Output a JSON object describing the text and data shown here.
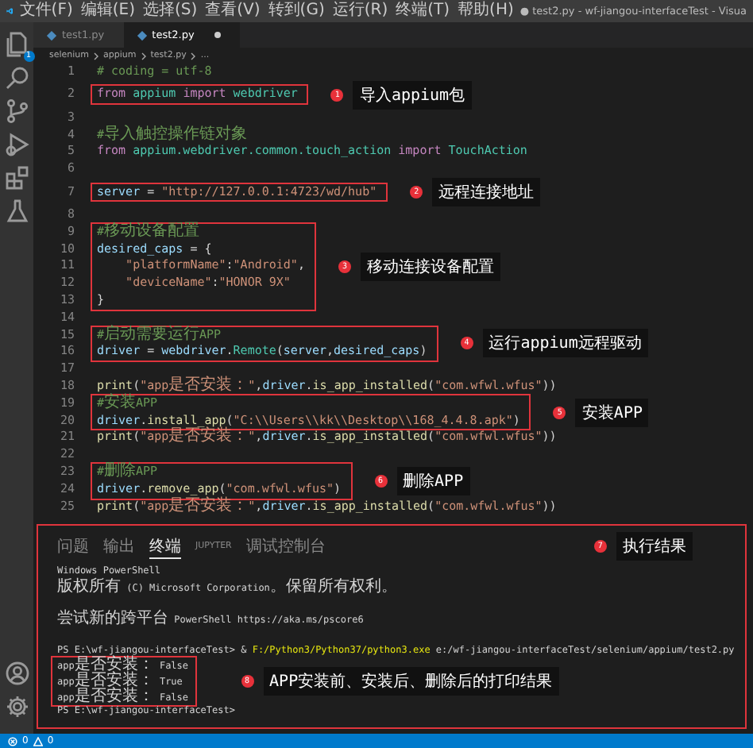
{
  "menu": [
    "文件(F)",
    "编辑(E)",
    "选择(S)",
    "查看(V)",
    "转到(G)",
    "运行(R)",
    "终端(T)",
    "帮助(H)"
  ],
  "window": {
    "title": "● test2.py - wf-jiangou-interfaceTest - Visua"
  },
  "activity_bar": {
    "top": [
      {
        "kind": "files",
        "badge": "1"
      },
      {
        "kind": "search"
      },
      {
        "kind": "source-control"
      },
      {
        "kind": "run"
      },
      {
        "kind": "extensions"
      },
      {
        "kind": "testing"
      }
    ],
    "bottom": [
      {
        "kind": "account"
      },
      {
        "kind": "settings"
      }
    ]
  },
  "tabs": [
    {
      "label": "test1.py",
      "selected": false,
      "modified": false
    },
    {
      "label": "test2.py",
      "selected": true,
      "modified": true
    }
  ],
  "breadcrumb": [
    "selenium",
    "appium",
    "test2.py",
    "..."
  ],
  "code_blocks": [
    {
      "boxed": false,
      "lines": [
        {
          "number": "1",
          "tokens": [
            {
              "kind": "comment",
              "text": "# coding = utf-8"
            }
          ]
        }
      ]
    },
    {
      "boxed": true,
      "callout": {
        "number": "1",
        "label": "导入appium包"
      },
      "lines": [
        {
          "number": "2",
          "tokens": [
            {
              "kind": "keyword",
              "text": "from "
            },
            {
              "kind": "module",
              "text": "appium "
            },
            {
              "kind": "keyword",
              "text": "import "
            },
            {
              "kind": "module",
              "text": "webdriver"
            }
          ]
        }
      ]
    },
    {
      "boxed": false,
      "lines": [
        {
          "number": "3"
        },
        {
          "number": "4",
          "tokens": [
            {
              "kind": "comment",
              "text": "#导入触控操作链对象"
            }
          ]
        },
        {
          "number": "5",
          "tokens": [
            {
              "kind": "keyword",
              "text": "from "
            },
            {
              "kind": "module",
              "text": "appium.webdriver.common.touch_action "
            },
            {
              "kind": "keyword",
              "text": "import "
            },
            {
              "kind": "class",
              "text": "TouchAction"
            }
          ]
        },
        {
          "number": "6"
        }
      ]
    },
    {
      "boxed": true,
      "callout": {
        "number": "2",
        "label": "远程连接地址"
      },
      "lines": [
        {
          "number": "7",
          "tokens": [
            {
              "kind": "name",
              "text": "server"
            },
            {
              "kind": "plain",
              "text": " = "
            },
            {
              "kind": "string",
              "text": "\"http://127.0.0.1:4723/wd/hub\""
            }
          ]
        }
      ]
    },
    {
      "boxed": false,
      "lines": [
        {
          "number": "8"
        }
      ]
    },
    {
      "boxed": true,
      "callout": {
        "number": "3",
        "label": "移动连接设备配置"
      },
      "lines": [
        {
          "number": "9",
          "tokens": [
            {
              "kind": "comment",
              "text": "#移动设备配置"
            }
          ]
        },
        {
          "number": "10",
          "tokens": [
            {
              "kind": "name",
              "text": "desired_caps"
            },
            {
              "kind": "plain",
              "text": " = {"
            }
          ]
        },
        {
          "number": "11",
          "tokens": [
            {
              "kind": "string",
              "text": "    \"platformName\""
            },
            {
              "kind": "plain",
              "text": ":"
            },
            {
              "kind": "string",
              "text": "\"Android\""
            },
            {
              "kind": "plain",
              "text": ","
            }
          ]
        },
        {
          "number": "12",
          "tokens": [
            {
              "kind": "string",
              "text": "    \"deviceName\""
            },
            {
              "kind": "plain",
              "text": ":"
            },
            {
              "kind": "string",
              "text": "\"HONOR 9X\""
            }
          ]
        },
        {
          "number": "13",
          "tokens": [
            {
              "kind": "plain",
              "text": "}"
            }
          ]
        }
      ]
    },
    {
      "boxed": false,
      "lines": [
        {
          "number": "14"
        }
      ]
    },
    {
      "boxed": true,
      "callout": {
        "number": "4",
        "label": "运行appium远程驱动"
      },
      "lines": [
        {
          "number": "15",
          "tokens": [
            {
              "kind": "comment",
              "text": "#启动需要运行APP"
            }
          ]
        },
        {
          "number": "16",
          "tokens": [
            {
              "kind": "name",
              "text": "driver"
            },
            {
              "kind": "plain",
              "text": " = "
            },
            {
              "kind": "name",
              "text": "webdriver"
            },
            {
              "kind": "plain",
              "text": "."
            },
            {
              "kind": "class",
              "text": "Remote"
            },
            {
              "kind": "plain",
              "text": "("
            },
            {
              "kind": "name",
              "text": "server"
            },
            {
              "kind": "plain",
              "text": ","
            },
            {
              "kind": "name",
              "text": "desired_caps"
            },
            {
              "kind": "plain",
              "text": ")"
            }
          ]
        }
      ]
    },
    {
      "boxed": false,
      "lines": [
        {
          "number": "17"
        },
        {
          "number": "18",
          "tokens": [
            {
              "kind": "func",
              "text": "print"
            },
            {
              "kind": "plain",
              "text": "("
            },
            {
              "kind": "string",
              "text": "\"app是否安装：\""
            },
            {
              "kind": "plain",
              "text": ","
            },
            {
              "kind": "name",
              "text": "driver"
            },
            {
              "kind": "plain",
              "text": "."
            },
            {
              "kind": "func",
              "text": "is_app_installed"
            },
            {
              "kind": "plain",
              "text": "("
            },
            {
              "kind": "string",
              "text": "\"com.wfwl.wfus\""
            },
            {
              "kind": "plain",
              "text": "))"
            }
          ]
        }
      ]
    },
    {
      "boxed": true,
      "callout": {
        "number": "5",
        "label": "安装APP"
      },
      "lines": [
        {
          "number": "19",
          "tokens": [
            {
              "kind": "comment",
              "text": "#安装APP"
            }
          ]
        },
        {
          "number": "20",
          "tokens": [
            {
              "kind": "name",
              "text": "driver"
            },
            {
              "kind": "plain",
              "text": "."
            },
            {
              "kind": "func",
              "text": "install_app"
            },
            {
              "kind": "plain",
              "text": "("
            },
            {
              "kind": "string",
              "text": "\"C:\\\\Users\\\\kk\\\\Desktop\\\\168_4.4.8.apk\""
            },
            {
              "kind": "plain",
              "text": ")"
            }
          ]
        }
      ]
    },
    {
      "boxed": false,
      "lines": [
        {
          "number": "21",
          "tokens": [
            {
              "kind": "func",
              "text": "print"
            },
            {
              "kind": "plain",
              "text": "("
            },
            {
              "kind": "string",
              "text": "\"app是否安装：\""
            },
            {
              "kind": "plain",
              "text": ","
            },
            {
              "kind": "name",
              "text": "driver"
            },
            {
              "kind": "plain",
              "text": "."
            },
            {
              "kind": "func",
              "text": "is_app_installed"
            },
            {
              "kind": "plain",
              "text": "("
            },
            {
              "kind": "string",
              "text": "\"com.wfwl.wfus\""
            },
            {
              "kind": "plain",
              "text": "))"
            }
          ]
        },
        {
          "number": "22"
        }
      ]
    },
    {
      "boxed": true,
      "callout": {
        "number": "6",
        "label": "删除APP"
      },
      "lines": [
        {
          "number": "23",
          "tokens": [
            {
              "kind": "comment",
              "text": "#删除APP"
            }
          ]
        },
        {
          "number": "24",
          "tokens": [
            {
              "kind": "name",
              "text": "driver"
            },
            {
              "kind": "plain",
              "text": "."
            },
            {
              "kind": "func",
              "text": "remove_app"
            },
            {
              "kind": "plain",
              "text": "("
            },
            {
              "kind": "string",
              "text": "\"com.wfwl.wfus\""
            },
            {
              "kind": "plain",
              "text": ")"
            }
          ]
        }
      ]
    },
    {
      "boxed": false,
      "lines": [
        {
          "number": "25",
          "tokens": [
            {
              "kind": "func",
              "text": "print"
            },
            {
              "kind": "plain",
              "text": "("
            },
            {
              "kind": "string",
              "text": "\"app是否安装：\""
            },
            {
              "kind": "plain",
              "text": ","
            },
            {
              "kind": "name",
              "text": "driver"
            },
            {
              "kind": "plain",
              "text": "."
            },
            {
              "kind": "func",
              "text": "is_app_installed"
            },
            {
              "kind": "plain",
              "text": "("
            },
            {
              "kind": "string",
              "text": "\"com.wfwl.wfus\""
            },
            {
              "kind": "plain",
              "text": "))"
            }
          ]
        }
      ]
    }
  ],
  "terminal": {
    "boxed": true,
    "callout": {
      "number": "7",
      "label": "执行结果"
    },
    "tabs": [
      {
        "label": "问题",
        "selected": false
      },
      {
        "label": "输出",
        "selected": false
      },
      {
        "label": "终端",
        "selected": true
      },
      {
        "label": "JUPYTER",
        "selected": false
      },
      {
        "label": "调试控制台",
        "selected": false
      }
    ],
    "blocks": [
      {
        "boxed": false,
        "lines": [
          {
            "kind": "text",
            "tokens": [
              {
                "kind": "plain",
                "text": "Windows PowerShell"
              }
            ]
          },
          {
            "kind": "text",
            "tokens": [
              {
                "kind": "plain",
                "text": "版权所有 (C) Microsoft Corporation。保留所有权利。"
              }
            ]
          },
          {
            "kind": "blank"
          },
          {
            "kind": "text",
            "tokens": [
              {
                "kind": "plain",
                "text": "尝试新的跨平台 PowerShell https://aka.ms/pscore6"
              }
            ]
          },
          {
            "kind": "blank"
          },
          {
            "kind": "text",
            "tokens": [
              {
                "kind": "plain",
                "text": "PS E:\\wf-jiangou-interfaceTest> & "
              },
              {
                "kind": "path",
                "text": "F:/Python3/Python37/python3.exe"
              },
              {
                "kind": "plain",
                "text": " e:/wf-jiangou-interfaceTest/selenium/appium/test2.py"
              }
            ]
          }
        ]
      },
      {
        "boxed": true,
        "callout": {
          "number": "8",
          "label": "APP安装前、安装后、删除后的打印结果"
        },
        "lines": [
          {
            "kind": "text",
            "tokens": [
              {
                "kind": "plain",
                "text": "app是否安装： False"
              }
            ]
          },
          {
            "kind": "text",
            "tokens": [
              {
                "kind": "plain",
                "text": "app是否安装： True"
              }
            ]
          },
          {
            "kind": "text",
            "tokens": [
              {
                "kind": "plain",
                "text": "app是否安装： False"
              }
            ]
          }
        ]
      },
      {
        "boxed": false,
        "lines": [
          {
            "kind": "text",
            "tokens": [
              {
                "kind": "plain",
                "text": "PS E:\\wf-jiangou-interfaceTest>"
              }
            ]
          }
        ]
      }
    ]
  },
  "status_bar": {
    "errors": "0",
    "warnings": "0"
  }
}
